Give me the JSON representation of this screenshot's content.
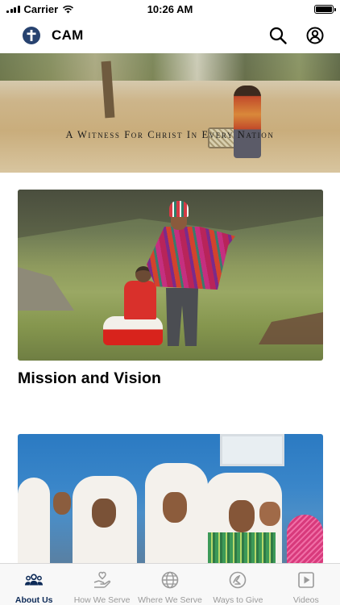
{
  "status_bar": {
    "carrier": "Carrier",
    "time": "10:26 AM",
    "battery_level": 1.0
  },
  "header": {
    "title": "CAM",
    "logo_icon": "cross-logo-icon",
    "actions": [
      {
        "icon": "search-icon"
      },
      {
        "icon": "account-icon"
      }
    ]
  },
  "hero": {
    "caption": "A Witness For Christ In Every Nation"
  },
  "cards": [
    {
      "title": "Mission and Vision"
    },
    {
      "title": ""
    }
  ],
  "tab_bar": {
    "active_index": 0,
    "tabs": [
      {
        "label": "About Us",
        "icon": "people-icon"
      },
      {
        "label": "How We Serve",
        "icon": "hand-heart-icon"
      },
      {
        "label": "Where We Serve",
        "icon": "globe-icon"
      },
      {
        "label": "Ways to Give",
        "icon": "give-icon"
      },
      {
        "label": "Videos",
        "icon": "play-square-icon"
      }
    ]
  },
  "colors": {
    "brand": "#0d2a57",
    "logo_bg": "#27426f",
    "tab_inactive": "#9a9a9a"
  }
}
